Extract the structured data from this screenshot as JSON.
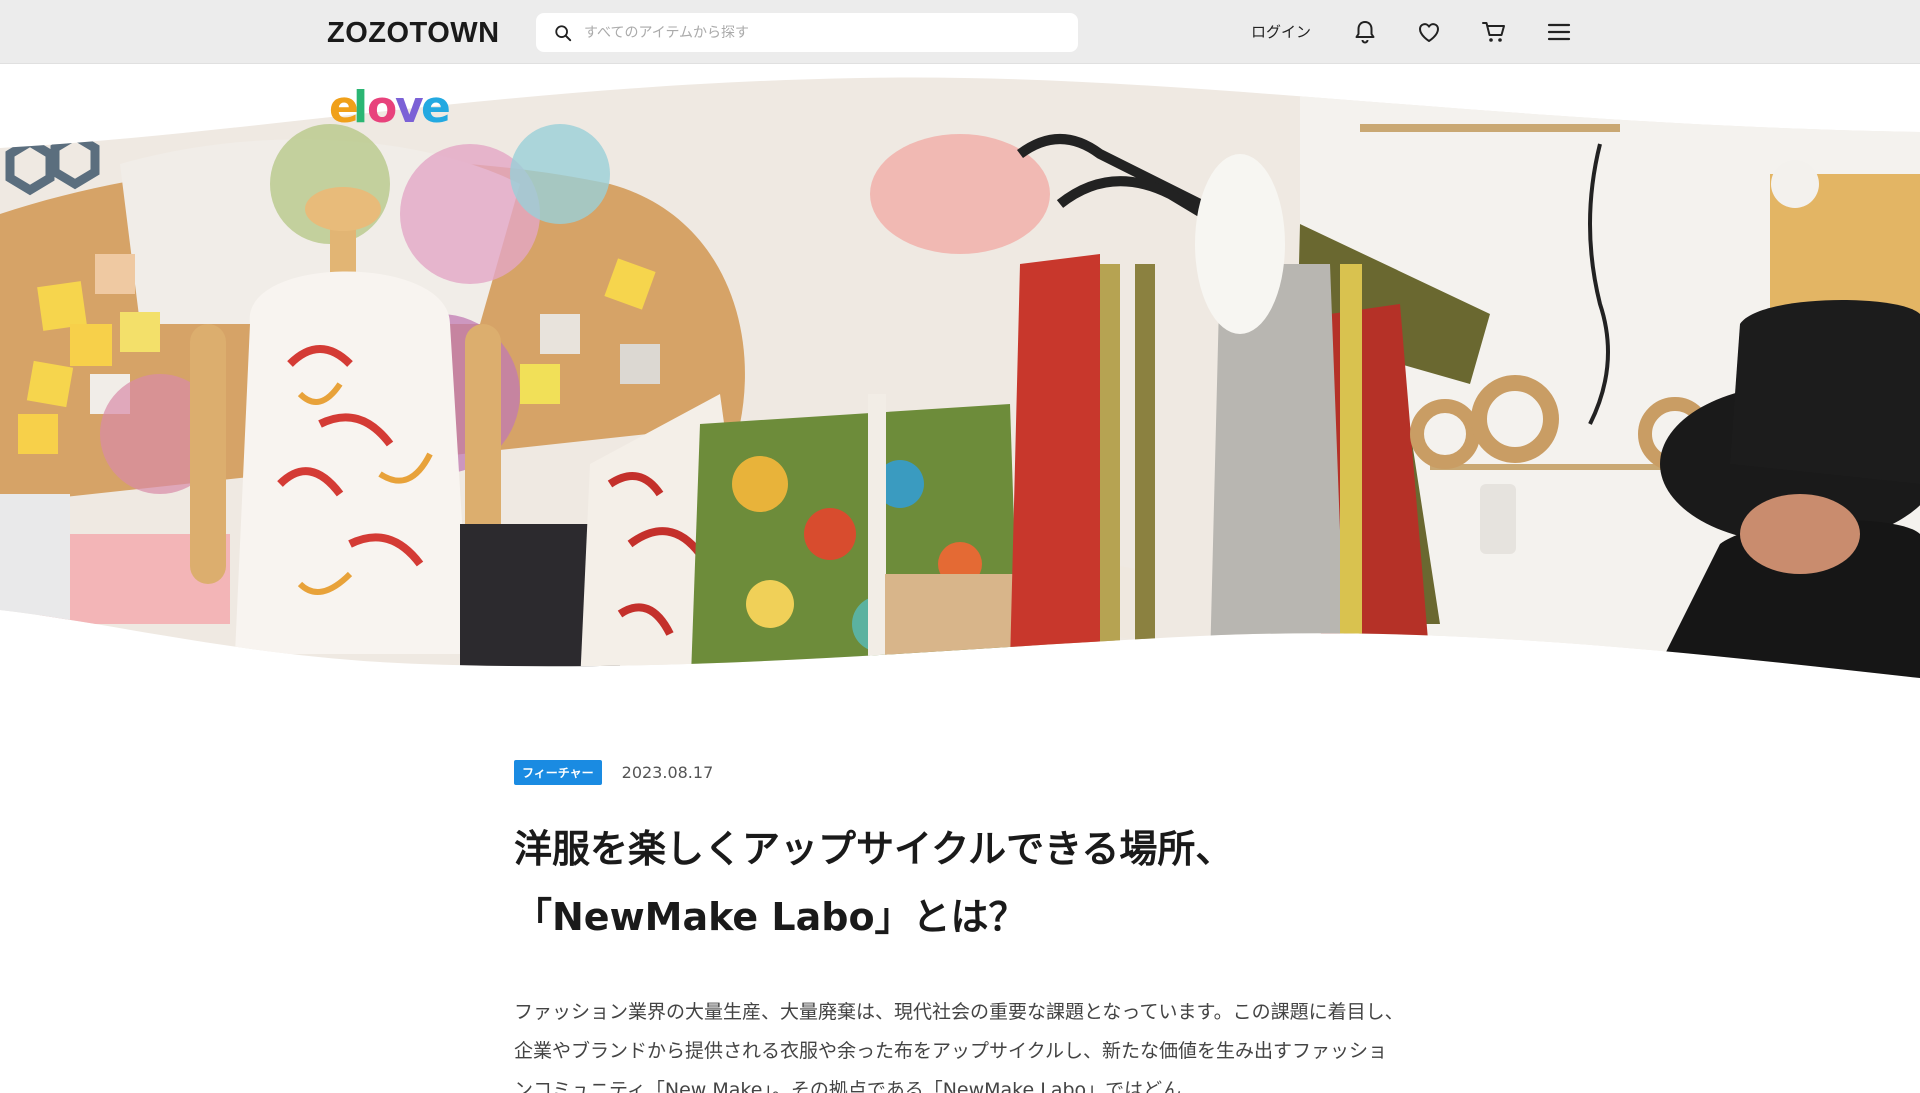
{
  "header": {
    "logo": "ZOZOTOWN",
    "search_placeholder": "すべてのアイテムから探す",
    "login_label": "ログイン"
  },
  "brand": {
    "logo": "elove"
  },
  "article": {
    "tag": "フィーチャー",
    "date": "2023.08.17",
    "title_line1": "洋服を楽しくアップサイクルできる場所、",
    "title_line2": "「NewMake Labo」とは？",
    "lead": "ファッション業界の大量生産、大量廃棄は、現代社会の重要な課題となっています。この課題に着目し、企業やブランドから提供される衣服や余った布をアップサイクルし、新たな価値を生み出すファッションコミュニティ「New Make」。その拠点である「NewMake Labo」ではどん"
  },
  "colors": {
    "header_bg": "#ececec",
    "tag_bg": "#1a8be2"
  }
}
